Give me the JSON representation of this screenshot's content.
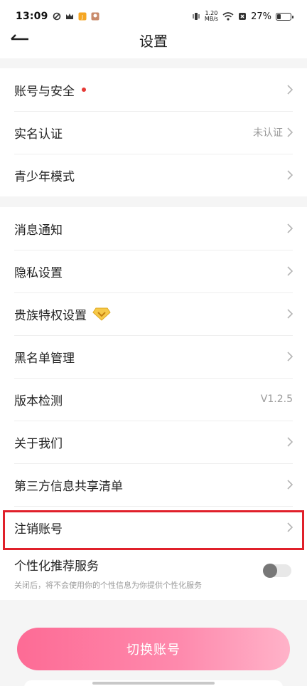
{
  "status_bar": {
    "time": "13:09",
    "net_speed_value": "1.20",
    "net_speed_unit": "MB/s",
    "battery_percent": "27%",
    "battery_level": 0.27
  },
  "header": {
    "title": "设置"
  },
  "groups": [
    {
      "items": [
        {
          "label": "账号与安全",
          "has_dot": true
        },
        {
          "label": "实名认证",
          "value": "未认证"
        },
        {
          "label": "青少年模式"
        }
      ]
    },
    {
      "items": [
        {
          "label": "消息通知"
        },
        {
          "label": "隐私设置"
        },
        {
          "label": "贵族特权设置",
          "icon": "diamond-icon"
        },
        {
          "label": "黑名单管理"
        },
        {
          "label": "版本检测",
          "value": "V1.2.5"
        },
        {
          "label": "关于我们"
        },
        {
          "label": "第三方信息共享清单"
        },
        {
          "label": "注销账号"
        }
      ]
    }
  ],
  "personalized": {
    "title": "个性化推荐服务",
    "description": "关闭后，将不会使用你的个性信息为你提供个性化服务",
    "enabled": false
  },
  "switch_account": {
    "label": "切换账号"
  },
  "colors": {
    "accent": "#fd6b95",
    "highlight_box": "#e0202a",
    "red_dot": "#e53935"
  }
}
